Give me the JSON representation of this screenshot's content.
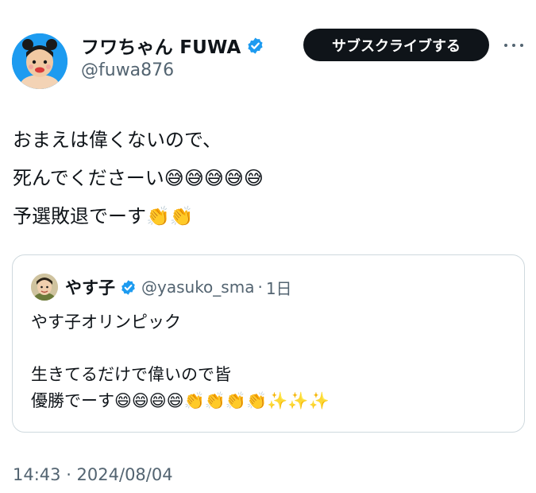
{
  "author": {
    "display_name": "フワちゃん FUWA",
    "handle": "@fuwa876",
    "verified_icon": "verified-badge-icon",
    "accent_color": "#1d9bf0"
  },
  "actions": {
    "subscribe_label": "サブスクライブする",
    "more_icon": "more-horizontal-icon"
  },
  "tweet": {
    "lines": [
      "おまえは偉くないので、",
      "死んでくださーい😅😅😅😅😅",
      "予選敗退でーす👏👏"
    ]
  },
  "quoted_tweet": {
    "display_name": "やす子",
    "handle": "@yasuko_sma",
    "separator": "·",
    "time": "1日",
    "lines": [
      "やす子オリンピック",
      "",
      "生きてるだけで偉いので皆",
      "優勝でーす😄😄😄😄👏👏👏👏✨✨✨"
    ]
  },
  "timestamp": "14:43 · 2024/08/04"
}
